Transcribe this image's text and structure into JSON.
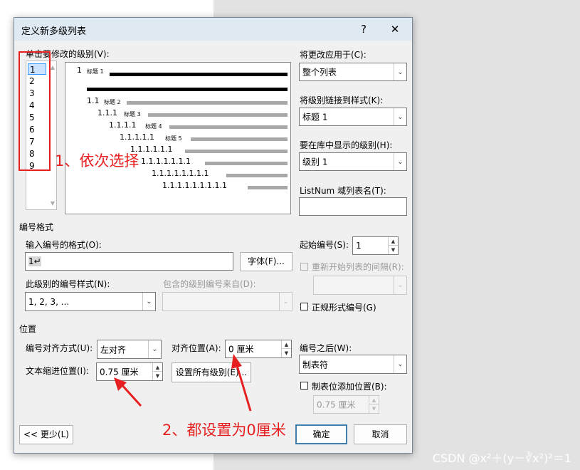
{
  "dialog": {
    "title": "定义新多级列表",
    "help_btn": "?",
    "close_btn": "✕"
  },
  "level_section": {
    "label": "单击要修改的级别(V):",
    "levels": [
      "1",
      "2",
      "3",
      "4",
      "5",
      "6",
      "7",
      "8",
      "9"
    ],
    "selected": "1"
  },
  "preview": {
    "rows": [
      {
        "num": "1",
        "heading": "标题 1"
      },
      {
        "num": "",
        "heading": ""
      },
      {
        "num": "1.1",
        "heading": "标题 2"
      },
      {
        "num": "1.1.1",
        "heading": "标题 3"
      },
      {
        "num": "1.1.1.1",
        "heading": "标题 4"
      },
      {
        "num": "1.1.1.1.1",
        "heading": "标题 5"
      },
      {
        "num": "1.1.1.1.1.1",
        "heading": ""
      },
      {
        "num": "1.1.1.1.1.1.1",
        "heading": ""
      },
      {
        "num": "1.1.1.1.1.1.1.1",
        "heading": ""
      },
      {
        "num": "1.1.1.1.1.1.1.1.1",
        "heading": ""
      }
    ]
  },
  "right_panel": {
    "apply_to_label": "将更改应用于(C):",
    "apply_to_value": "整个列表",
    "link_style_label": "将级别链接到样式(K):",
    "link_style_value": "标题 1",
    "gallery_level_label": "要在库中显示的级别(H):",
    "gallery_level_value": "级别 1",
    "listnum_label": "ListNum 域列表名(T):",
    "listnum_value": ""
  },
  "number_format": {
    "section_label": "编号格式",
    "format_label": "输入编号的格式(O):",
    "format_value": "1↵",
    "font_btn": "字体(F)...",
    "style_label": "此级别的编号样式(N):",
    "style_value": "1, 2, 3, ...",
    "include_label": "包含的级别编号来自(D):",
    "include_value": "",
    "start_label": "起始编号(S):",
    "start_value": "1",
    "restart_label": "重新开始列表的间隔(R):",
    "restart_value": "",
    "legal_label": "正规形式编号(G)"
  },
  "position": {
    "section_label": "位置",
    "align_label": "编号对齐方式(U):",
    "align_value": "左对齐",
    "align_at_label": "对齐位置(A):",
    "align_at_value": "0 厘米",
    "indent_label": "文本缩进位置(I):",
    "indent_value": "0.75 厘米",
    "set_all_btn": "设置所有级别(E)...",
    "follow_label": "编号之后(W):",
    "follow_value": "制表符",
    "tab_stop_label": "制表位添加位置(B):",
    "tab_stop_value": "0.75 厘米"
  },
  "footer": {
    "less_btn": "<< 更少(L)",
    "ok_btn": "确定",
    "cancel_btn": "取消"
  },
  "annotations": {
    "step1": "1、依次选择",
    "step2": "2、都设置为0厘米"
  },
  "watermark": "CSDN @x²＋(y－∛x²)²＝1",
  "colors": {
    "annotation": "#e62020",
    "selection": "#cce4ff",
    "ok_border": "#3c7fb1"
  }
}
